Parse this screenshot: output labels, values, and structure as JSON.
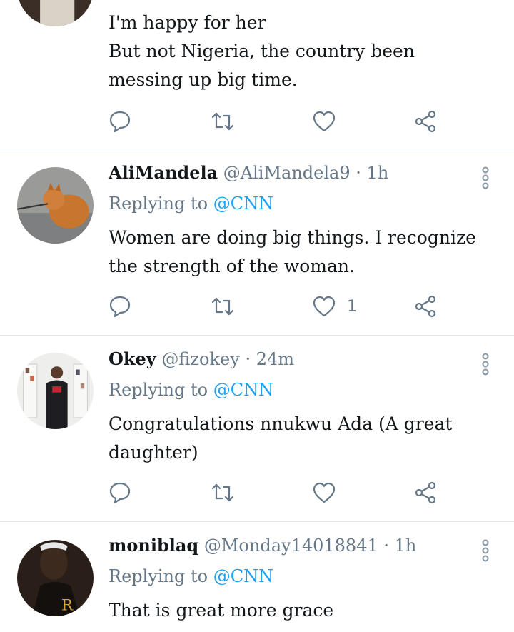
{
  "tweets": [
    {
      "body": [
        "I'm happy for her",
        "But not Nigeria, the country been messing up big time."
      ]
    },
    {
      "name": "AliMandela",
      "handle": "@AliMandela9",
      "dot": "·",
      "time": "1h",
      "replying_prefix": "Replying to",
      "replying_to": "@CNN",
      "body": [
        "Women are doing big things. I recognize the strength of the woman."
      ],
      "like_count": "1"
    },
    {
      "name": "Okey",
      "handle": "@fizokey",
      "dot": "·",
      "time": "24m",
      "replying_prefix": "Replying to",
      "replying_to": "@CNN",
      "body": [
        "Congratulations nnukwu Ada (A great daughter)"
      ]
    },
    {
      "name": "moniblaq",
      "handle": "@Monday14018841",
      "dot": "·",
      "time": "1h",
      "replying_prefix": "Replying to",
      "replying_to": "@CNN",
      "body": [
        "That is great more grace"
      ]
    }
  ],
  "icons": {
    "reply": "reply-icon",
    "retweet": "retweet-icon",
    "like": "heart-icon",
    "share": "share-icon",
    "more": "more-options-icon"
  },
  "colors": {
    "secondary_text": "#657786",
    "mention": "#1da1f2",
    "divider": "#e1e8ed"
  }
}
